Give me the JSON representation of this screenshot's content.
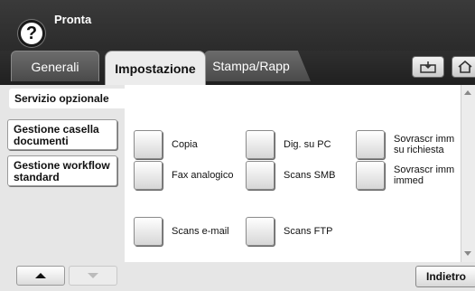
{
  "header": {
    "status": "Pronta",
    "help_icon": "?"
  },
  "tabs": [
    {
      "label": "Generali"
    },
    {
      "label": "Impostazione"
    },
    {
      "label": "Stampa/Rapp"
    }
  ],
  "toolbar_icons": [
    "tray-icon",
    "home-icon"
  ],
  "sidebar": {
    "active_label": "Servizio opzionale",
    "items": [
      {
        "label": "Gestione casella documenti"
      },
      {
        "label": "Gestione workflow standard"
      }
    ]
  },
  "options": [
    {
      "label": "Copia"
    },
    {
      "label": "Dig. su PC"
    },
    {
      "label": "Sovrascr imm su richiesta"
    },
    {
      "label": "Fax analogico"
    },
    {
      "label": "Scans SMB"
    },
    {
      "label": "Sovrascr imm immed"
    },
    {
      "label": "Scans e-mail"
    },
    {
      "label": "Scans FTP"
    }
  ],
  "footer": {
    "back_label": "Indietro"
  },
  "colors": {
    "header_bg": "#2b2b2b",
    "panel_bg": "#e6e6e6",
    "active_tab_bg": "#ececec"
  }
}
